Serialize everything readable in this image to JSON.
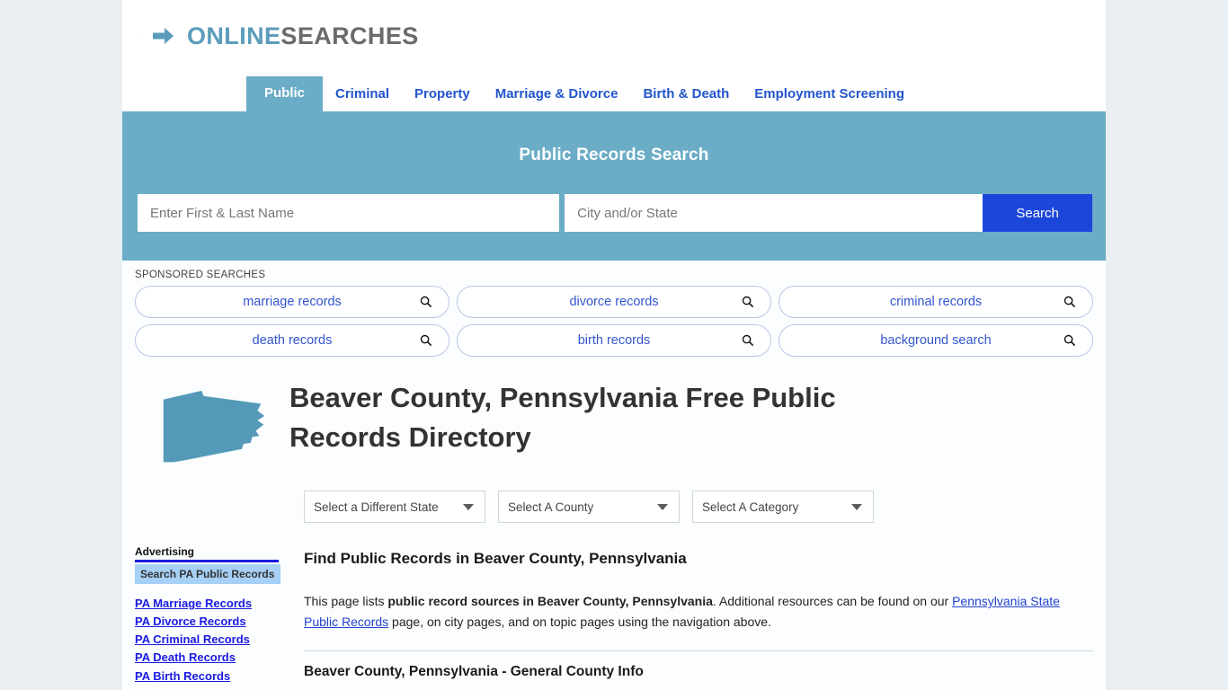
{
  "brand": {
    "logo_icon": "circle-arrow-logo-icon",
    "name_part1": "ONLINE",
    "name_part2": "SEARCHES"
  },
  "nav": {
    "tabs": [
      {
        "label": "Public",
        "active": true
      },
      {
        "label": "Criminal",
        "active": false
      },
      {
        "label": "Property",
        "active": false
      },
      {
        "label": "Marriage & Divorce",
        "active": false
      },
      {
        "label": "Birth & Death",
        "active": false
      },
      {
        "label": "Employment Screening",
        "active": false
      }
    ]
  },
  "search_band": {
    "title": "Public Records Search",
    "name_placeholder": "Enter First & Last Name",
    "name_value": "",
    "place_placeholder": "City and/or State",
    "place_value": "",
    "button_label": "Search",
    "band_color": "#6bacc6",
    "button_color": "#1c46d9"
  },
  "sponsored": {
    "label": "SPONSORED SEARCHES",
    "items": [
      {
        "label": "marriage records",
        "icon": "search-icon"
      },
      {
        "label": "divorce records",
        "icon": "search-icon"
      },
      {
        "label": "criminal records",
        "icon": "search-icon"
      },
      {
        "label": "death records",
        "icon": "search-icon"
      },
      {
        "label": "birth records",
        "icon": "search-icon"
      },
      {
        "label": "background search",
        "icon": "search-icon"
      }
    ]
  },
  "page": {
    "state_icon": "pennsylvania-state-outline-icon",
    "title": "Beaver County, Pennsylvania Free Public Records Directory"
  },
  "selectors": [
    {
      "label": "Select a Different State"
    },
    {
      "label": "Select A County"
    },
    {
      "label": "Select A Category"
    }
  ],
  "main": {
    "heading": "Find Public Records in Beaver County, Pennsylvania",
    "paragraph_part1": "This page lists ",
    "paragraph_bold": "public record sources in Beaver County, Pennsylvania",
    "paragraph_part2": ". Additional resources can be found on our ",
    "paragraph_link": "Pennsylvania State Public Records",
    "paragraph_part3": " page, on city pages, and on topic pages using the navigation above.",
    "section_heading": "Beaver County, Pennsylvania - General County Info"
  },
  "sidebar": {
    "ad_label": "Advertising",
    "ad_heading": "Search PA Public Records",
    "links": [
      "PA Marriage Records",
      "PA Divorce Records",
      "PA Criminal Records",
      "PA Death Records",
      "PA Birth Records"
    ]
  }
}
